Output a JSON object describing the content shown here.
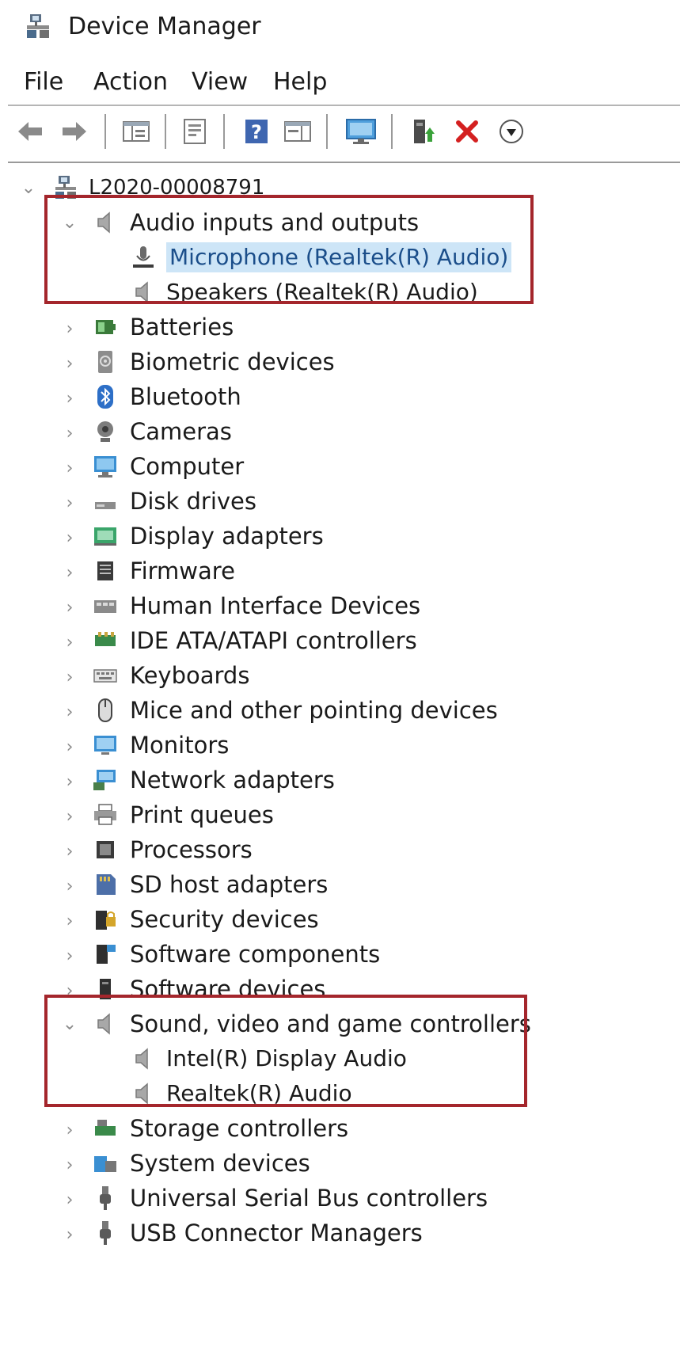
{
  "window": {
    "title": "Device Manager",
    "icon": "device-manager-icon"
  },
  "menu": {
    "items": [
      {
        "label": "File"
      },
      {
        "label": "Action"
      },
      {
        "label": "View"
      },
      {
        "label": "Help"
      }
    ]
  },
  "toolbar": {
    "buttons": [
      {
        "icon": "back-arrow-icon"
      },
      {
        "icon": "forward-arrow-icon"
      },
      {
        "icon": "show-hide-console-tree-icon"
      },
      {
        "icon": "properties-icon"
      },
      {
        "icon": "help-icon"
      },
      {
        "icon": "action-pane-icon"
      },
      {
        "icon": "scan-hardware-changes-icon"
      },
      {
        "icon": "update-driver-icon"
      },
      {
        "icon": "uninstall-device-icon"
      },
      {
        "icon": "disable-device-icon"
      }
    ]
  },
  "colors": {
    "highlight_box": "#a4262c",
    "selection_bg": "#cde5f7",
    "selection_text": "#1b4e8a"
  },
  "tree": {
    "root": {
      "label": "L2020-00008791",
      "expanded": true
    },
    "categories": [
      {
        "label": "Audio inputs and outputs",
        "expanded": true,
        "icon": "speaker-icon",
        "children": [
          {
            "label": "Microphone (Realtek(R) Audio)",
            "icon": "microphone-icon",
            "selected": true
          },
          {
            "label": "Speakers (Realtek(R) Audio)",
            "icon": "speaker-icon"
          }
        ]
      },
      {
        "label": "Batteries",
        "icon": "battery-icon"
      },
      {
        "label": "Biometric devices",
        "icon": "biometric-icon"
      },
      {
        "label": "Bluetooth",
        "icon": "bluetooth-icon"
      },
      {
        "label": "Cameras",
        "icon": "camera-icon"
      },
      {
        "label": "Computer",
        "icon": "computer-icon"
      },
      {
        "label": "Disk drives",
        "icon": "disk-drive-icon"
      },
      {
        "label": "Display adapters",
        "icon": "display-adapter-icon"
      },
      {
        "label": "Firmware",
        "icon": "firmware-icon"
      },
      {
        "label": "Human Interface Devices",
        "icon": "hid-icon"
      },
      {
        "label": "IDE ATA/ATAPI controllers",
        "icon": "ide-controller-icon"
      },
      {
        "label": "Keyboards",
        "icon": "keyboard-icon"
      },
      {
        "label": "Mice and other pointing devices",
        "icon": "mouse-icon"
      },
      {
        "label": "Monitors",
        "icon": "monitor-icon"
      },
      {
        "label": "Network adapters",
        "icon": "network-adapter-icon"
      },
      {
        "label": "Print queues",
        "icon": "printer-icon"
      },
      {
        "label": "Processors",
        "icon": "processor-icon"
      },
      {
        "label": "SD host adapters",
        "icon": "sd-card-icon"
      },
      {
        "label": "Security devices",
        "icon": "security-device-icon"
      },
      {
        "label": "Software components",
        "icon": "software-component-icon"
      },
      {
        "label": "Software devices",
        "icon": "software-device-icon"
      },
      {
        "label": "Sound, video and game controllers",
        "expanded": true,
        "icon": "speaker-icon",
        "children": [
          {
            "label": "Intel(R) Display Audio",
            "icon": "speaker-icon"
          },
          {
            "label": "Realtek(R) Audio",
            "icon": "speaker-icon"
          }
        ]
      },
      {
        "label": "Storage controllers",
        "icon": "storage-controller-icon"
      },
      {
        "label": "System devices",
        "icon": "system-device-icon"
      },
      {
        "label": "Universal Serial Bus controllers",
        "icon": "usb-icon"
      },
      {
        "label": "USB Connector Managers",
        "icon": "usb-icon"
      }
    ]
  }
}
